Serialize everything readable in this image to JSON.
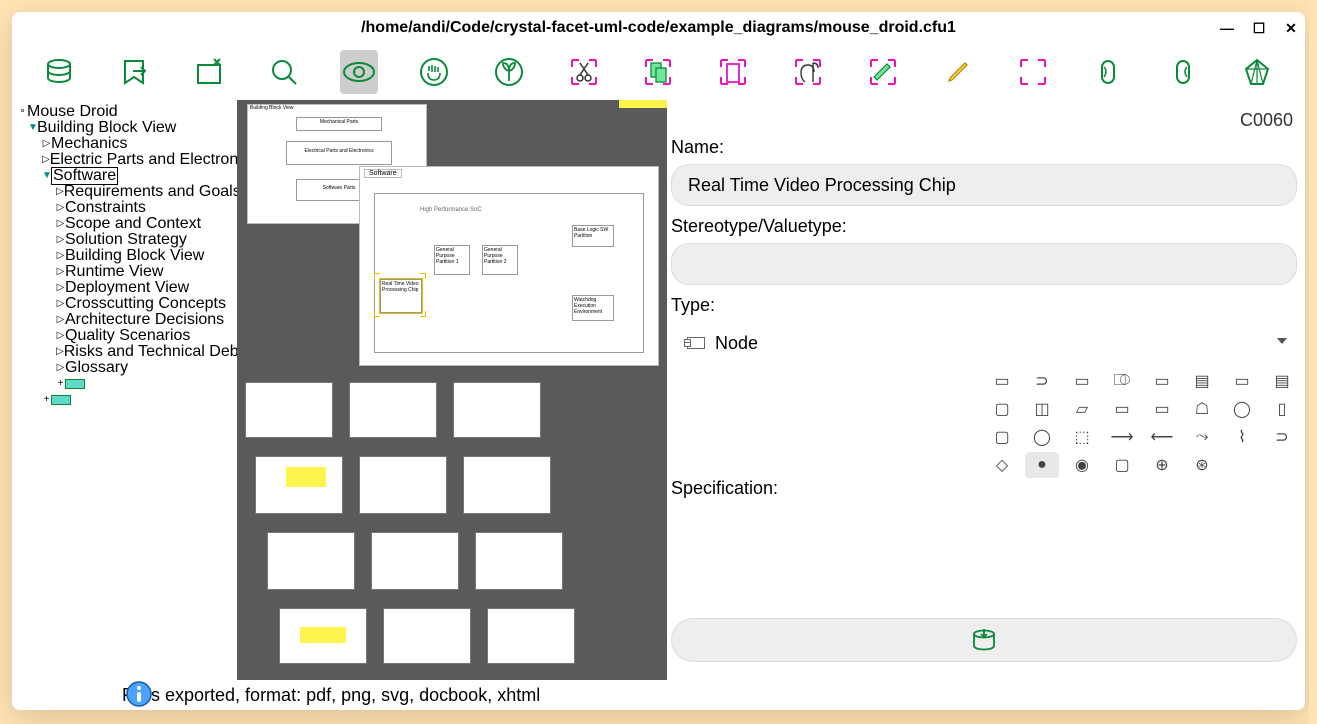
{
  "window": {
    "title": "/home/andi/Code/crystal-facet-uml-code/example_diagrams/mouse_droid.cfu1",
    "min": "—",
    "max": "☐",
    "close": "✕"
  },
  "tree": {
    "root": "Mouse Droid",
    "l1": "Building Block View",
    "l2a": "Mechanics",
    "l2b": "Electric Parts and Electronics",
    "l2c": "Software",
    "sw": {
      "a": "Requirements and Goals",
      "b": "Constraints",
      "c": "Scope and Context",
      "d": "Solution Strategy",
      "e": "Building Block View",
      "f": "Runtime View",
      "g": "Deployment View",
      "h": "Crosscutting Concepts",
      "i": "Architecture Decisions",
      "j": "Quality Scenarios",
      "k": "Risks and Technical Debts",
      "l": "Glossary"
    }
  },
  "diagram": {
    "tab": "Software",
    "title": "High Performance SoC",
    "boxes": {
      "a": "Real Time Video Processing Chip",
      "b": "General Purpose Partition 1",
      "c": "General Purpose Partition 2",
      "d": "Base Logic SW Partition",
      "e": "Watchdog Execution Environment"
    },
    "top_stack": {
      "a": "Building Block View",
      "b": "Mechanical Parts",
      "c": "Electrical Parts and Electronics",
      "d": "Software Parts"
    }
  },
  "props": {
    "id": "C0060",
    "label_name": "Name:",
    "name": "Real Time Video Processing Chip",
    "label_stereo": "Stereotype/Valuetype:",
    "stereo": "",
    "label_type": "Type:",
    "type": "Node",
    "label_spec": "Specification:"
  },
  "palette_glyphs": [
    "▢",
    "⊃",
    "▭",
    "⎄",
    "▭",
    "▤",
    "▭",
    "▤",
    "▢",
    "◫",
    "▱",
    "▭",
    "▭",
    "☖",
    "◯",
    "▯",
    "▢",
    "◯",
    "⬚",
    "⟶",
    "⟵",
    "⤳",
    "⌇",
    "⊃",
    "◇",
    "●",
    "◉",
    "◌",
    "⊕",
    "⊛",
    "",
    ""
  ],
  "status": "Files exported, format: pdf, png, svg, docbook, xhtml"
}
